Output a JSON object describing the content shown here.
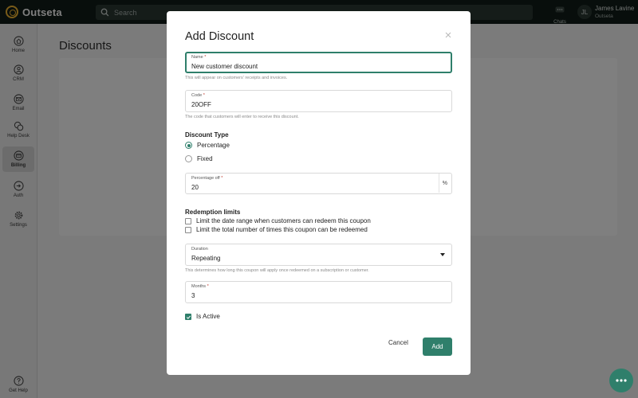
{
  "app": {
    "name": "Outseta"
  },
  "search": {
    "placeholder": "Search"
  },
  "header": {
    "chats_label": "Chats",
    "user_initials": "JL",
    "user_name": "James Lavine",
    "user_org": "Outseta"
  },
  "sidebar": {
    "items": [
      {
        "label": "Home",
        "icon": "home-icon"
      },
      {
        "label": "CRM",
        "icon": "person-icon"
      },
      {
        "label": "Email",
        "icon": "envelope-icon"
      },
      {
        "label": "Help Desk",
        "icon": "chat-bubbles-icon"
      },
      {
        "label": "Billing",
        "icon": "wallet-icon",
        "active": true
      },
      {
        "label": "Auth",
        "icon": "login-icon"
      },
      {
        "label": "Settings",
        "icon": "gear-icon"
      }
    ],
    "help_label": "Get Help"
  },
  "page": {
    "title": "Discounts"
  },
  "modal": {
    "title": "Add Discount",
    "name": {
      "label": "Name",
      "value": "New customer discount",
      "help": "This will appear on customers' receipts and invoices."
    },
    "code": {
      "label": "Code",
      "value": "20OFF",
      "help": "The code that customers will enter to receive this discount."
    },
    "discount_type": {
      "title": "Discount Type",
      "options": [
        "Percentage",
        "Fixed"
      ],
      "selected": "Percentage"
    },
    "percentage_off": {
      "label": "Percentage off",
      "value": "20",
      "suffix": "%"
    },
    "redemption": {
      "title": "Redemption limits",
      "options": [
        {
          "label": "Limit the date range when customers can redeem this coupon",
          "checked": false
        },
        {
          "label": "Limit the total number of times this coupon can be redeemed",
          "checked": false
        }
      ]
    },
    "duration": {
      "label": "Duration",
      "value": "Repeating",
      "help": "This determines how long this coupon will apply once redeemed on a subscription or customer."
    },
    "months": {
      "label": "Months",
      "value": "3"
    },
    "is_active": {
      "label": "Is Active",
      "checked": true
    },
    "cancel_label": "Cancel",
    "add_label": "Add"
  },
  "required_marker": "*",
  "colors": {
    "brand": "#2f7f6b",
    "topbar": "#111d18",
    "logo": "#f2b632"
  }
}
